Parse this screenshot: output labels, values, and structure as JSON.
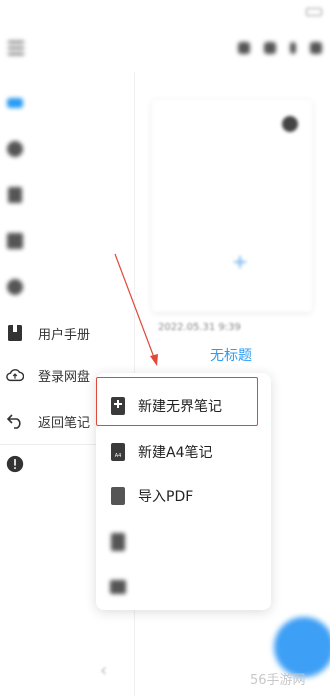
{
  "status_bar": {
    "left_text": "",
    "time": "",
    "battery": ""
  },
  "topbar": {
    "title": "",
    "icons": [
      "menu-toggle-icon",
      "settings-icon",
      "filter-icon",
      "more-icon",
      "search-icon"
    ]
  },
  "sidebar": {
    "items": [
      {
        "label": "",
        "icon": "blue-tab-icon",
        "active": true
      },
      {
        "label": "",
        "icon": "gear-icon"
      },
      {
        "label": "",
        "icon": "doc-icon"
      },
      {
        "label": "",
        "icon": "grid-icon"
      },
      {
        "label": "",
        "icon": "gear-icon"
      },
      {
        "label": "用户手册",
        "icon": "book-icon"
      },
      {
        "label": "登录网盘",
        "icon": "cloud-icon"
      },
      {
        "label": "返回笔记",
        "icon": "back-icon"
      },
      {
        "label": "",
        "icon": "alert-icon"
      }
    ]
  },
  "note": {
    "date": "2022.05.31 9:39",
    "title": "无标题"
  },
  "popup": {
    "items": [
      {
        "label": "新建无界笔记",
        "icon": "new-note-icon"
      },
      {
        "label": "新建A4笔记",
        "icon": "a4-note-icon",
        "icon_text": "A4"
      },
      {
        "label": "导入PDF",
        "icon": "pdf-icon"
      },
      {
        "label": "",
        "icon": "image-icon"
      },
      {
        "label": "",
        "icon": "folder-icon"
      }
    ]
  },
  "bottom": {
    "collapse": "‹",
    "watermark": "56手游网"
  },
  "colors": {
    "accent": "#2a9df4",
    "highlight": "#e0483a",
    "fab": "#3d9ff5"
  }
}
